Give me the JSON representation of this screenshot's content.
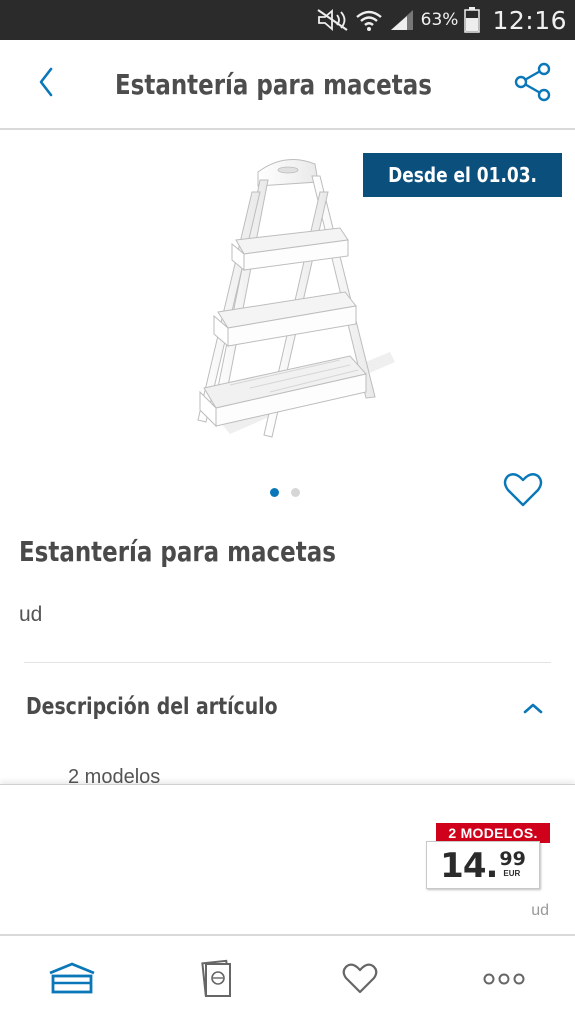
{
  "status_bar": {
    "battery_percent": "63%",
    "time": "12:16",
    "icons": [
      "mute-icon",
      "wifi-icon",
      "signal-icon",
      "battery-icon"
    ]
  },
  "header": {
    "title": "Estantería para macetas",
    "back_icon": "chevron-left-icon",
    "share_icon": "share-icon"
  },
  "gallery": {
    "date_badge": "Desde el  01.03.",
    "page_count": 2,
    "active_page": 1,
    "favorite_icon": "heart-outline-icon"
  },
  "product": {
    "name": "Estantería para macetas",
    "unit": "ud"
  },
  "description": {
    "title": "Descripción del artículo",
    "expanded": true,
    "first_item": "2 modelos"
  },
  "price": {
    "models_badge": "2 MODELOS.",
    "integer": "14.",
    "cents": "99",
    "currency": "EUR",
    "unit": "ud"
  },
  "bottom_nav": {
    "items": [
      {
        "icon": "home-icon",
        "active": true
      },
      {
        "icon": "leaflet-icon",
        "active": false
      },
      {
        "icon": "heart-icon",
        "active": false
      },
      {
        "icon": "more-icon",
        "active": false
      }
    ]
  },
  "colors": {
    "accent_blue": "#0a78b8",
    "badge_navy": "#0b4f7d",
    "badge_red": "#d0021b",
    "text": "#4a4a4a"
  }
}
